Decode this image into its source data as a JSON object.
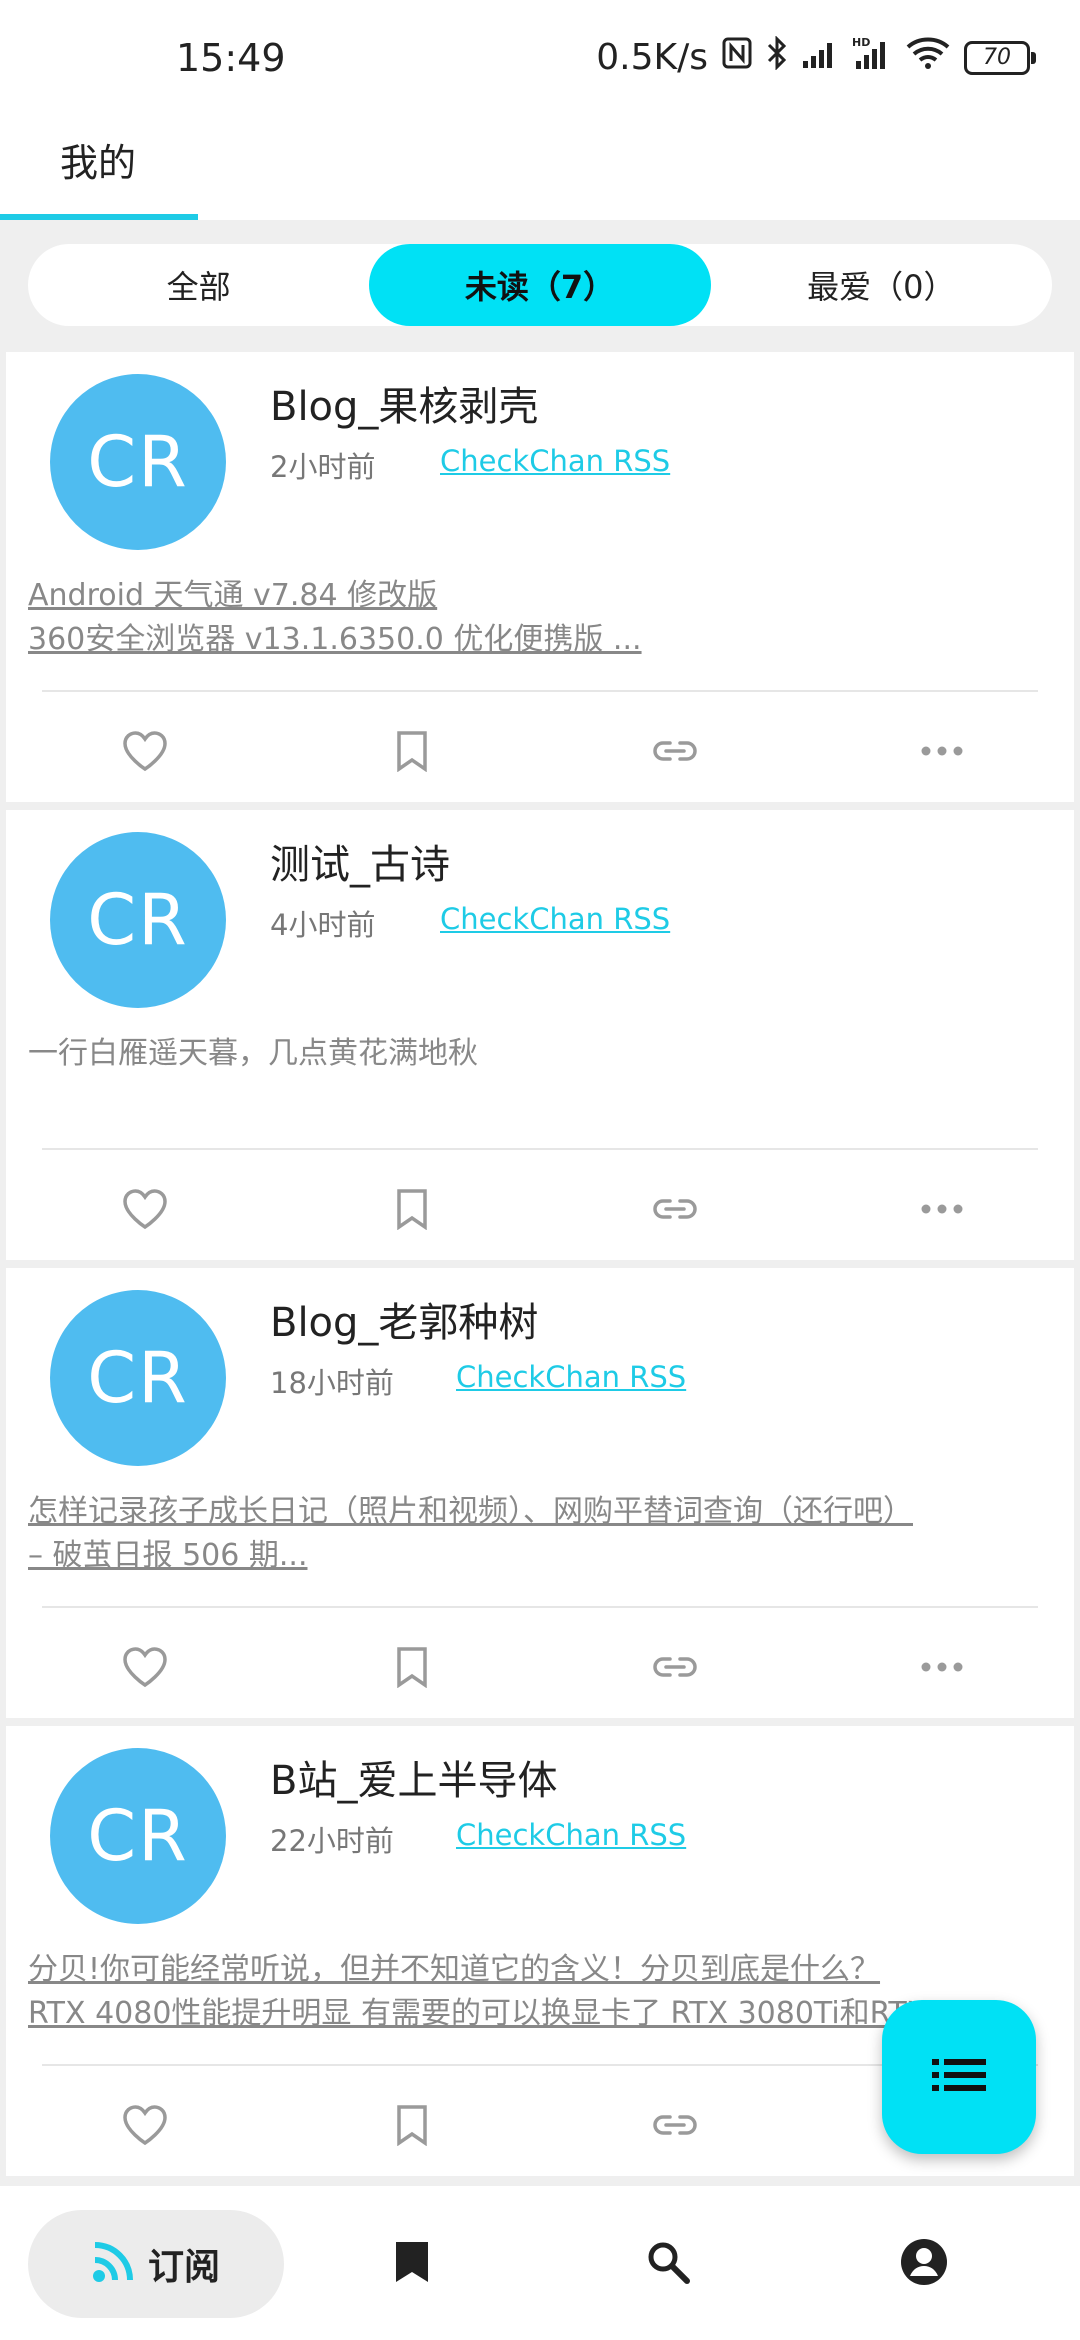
{
  "status_bar": {
    "time": "15:49",
    "net_speed": "0.5K/s",
    "battery": "70",
    "icons": [
      "nfc-icon",
      "bluetooth-icon",
      "signal-icon",
      "hd-signal-icon",
      "wifi-icon",
      "battery-icon"
    ]
  },
  "header": {
    "tab_label": "我的"
  },
  "segments": [
    {
      "label": "全部",
      "active": false
    },
    {
      "label": "未读（7）",
      "active": true
    },
    {
      "label": "最爱（0）",
      "active": false
    }
  ],
  "cards": [
    {
      "avatar": "CR",
      "title": "Blog_果核剥壳",
      "time": "2小时前",
      "source": "CheckChan RSS",
      "summary_lines": [
        "Android 天气通 v7.84 修改版",
        "360安全浏览器 v13.1.6350.0 优化便携版 ..."
      ],
      "summary_link": true
    },
    {
      "avatar": "CR",
      "title": "测试_古诗",
      "time": "4小时前",
      "source": "CheckChan RSS",
      "summary_lines": [
        "一行白雁遥天暮，几点黄花满地秋"
      ],
      "summary_link": false
    },
    {
      "avatar": "CR",
      "title": "Blog_老郭种树",
      "time": "18小时前",
      "source": "CheckChan RSS",
      "summary_lines": [
        "怎样记录孩子成长日记（照片和视频）、网购平替词查询（还行吧）",
        "– 破茧日报 506 期..."
      ],
      "summary_link": true
    },
    {
      "avatar": "CR",
      "title": "B站_爱上半导体",
      "time": "22小时前",
      "source": "CheckChan RSS",
      "summary_lines": [
        "分贝!你可能经常听说，但并不知道它的含义！分贝到底是什么？",
        "RTX 4080性能提升明显 有需要的可以换显卡了 RTX 3080Ti和RTX 40..."
      ],
      "summary_link": true
    }
  ],
  "card_actions": [
    "heart-icon",
    "bookmark-icon",
    "link-icon",
    "more-icon"
  ],
  "fab": {
    "icon": "list-icon"
  },
  "bottom_nav": {
    "items": [
      {
        "label": "订阅",
        "icon": "rss-icon",
        "active": true
      },
      {
        "label": "",
        "icon": "bookmark-icon",
        "active": false
      },
      {
        "label": "",
        "icon": "search-icon",
        "active": false
      },
      {
        "label": "",
        "icon": "account-icon",
        "active": false
      }
    ]
  },
  "colors": {
    "accent": "#00e1f5",
    "avatar": "#4fbcf0",
    "link": "#1ecbe6",
    "rss_icon": "#1ecbe6"
  }
}
